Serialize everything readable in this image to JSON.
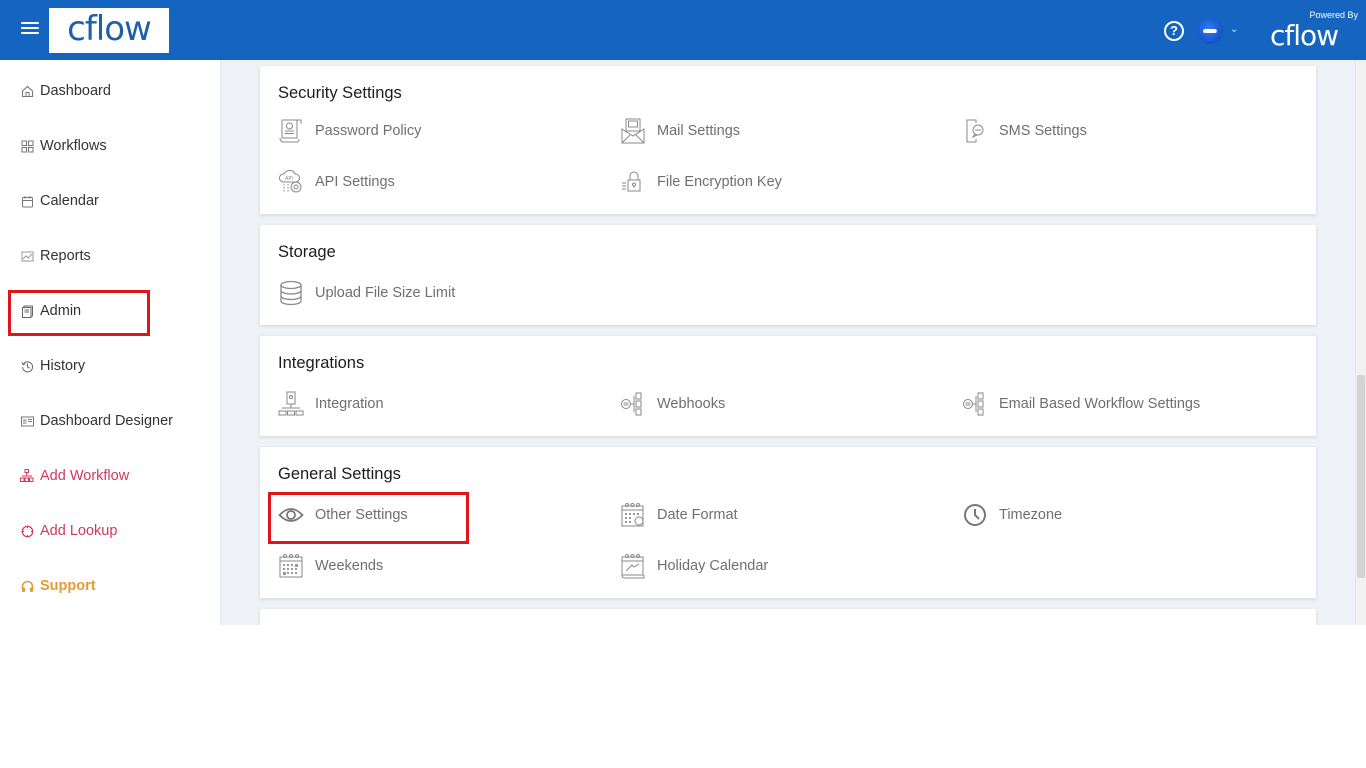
{
  "header": {
    "logo_text": "cflow",
    "powered_by_label": "Powered By",
    "powered_by_logo": "cflow",
    "help_icon": "?",
    "avatar_caret": "⌄",
    "brand_color": "#1565c0"
  },
  "sidebar": {
    "items": [
      {
        "label": "Dashboard",
        "icon": "home-icon"
      },
      {
        "label": "Workflows",
        "icon": "grid-icon"
      },
      {
        "label": "Calendar",
        "icon": "calendar-icon"
      },
      {
        "label": "Reports",
        "icon": "reports-icon"
      },
      {
        "label": "Admin",
        "icon": "admin-icon"
      },
      {
        "label": "History",
        "icon": "history-icon"
      },
      {
        "label": "Dashboard Designer",
        "icon": "dashboard-designer-icon"
      },
      {
        "label": "Add Workflow",
        "icon": "add-workflow-icon"
      },
      {
        "label": "Add Lookup",
        "icon": "add-lookup-icon"
      },
      {
        "label": "Support",
        "icon": "headset-icon"
      }
    ],
    "accent_pink": "#d2395a",
    "accent_orange": "#e39a3a",
    "highlight_color": "#e0151b"
  },
  "sections": [
    {
      "title": "Security Settings",
      "items": [
        {
          "label": "Password Policy",
          "icon": "password-policy-icon"
        },
        {
          "label": "Mail Settings",
          "icon": "mail-icon"
        },
        {
          "label": "SMS Settings",
          "icon": "sms-icon"
        },
        {
          "label": "API Settings",
          "icon": "api-icon"
        },
        {
          "label": "File Encryption Key",
          "icon": "lock-icon"
        }
      ]
    },
    {
      "title": "Storage",
      "items": [
        {
          "label": "Upload File Size Limit",
          "icon": "database-icon"
        }
      ]
    },
    {
      "title": "Integrations",
      "items": [
        {
          "label": "Integration",
          "icon": "integration-icon"
        },
        {
          "label": "Webhooks",
          "icon": "webhooks-icon"
        },
        {
          "label": "Email Based Workflow Settings",
          "icon": "email-workflow-icon"
        }
      ]
    },
    {
      "title": "General Settings",
      "items": [
        {
          "label": "Other Settings",
          "icon": "eye-icon"
        },
        {
          "label": "Date Format",
          "icon": "date-format-icon"
        },
        {
          "label": "Timezone",
          "icon": "clock-icon"
        },
        {
          "label": "Weekends",
          "icon": "weekends-icon"
        },
        {
          "label": "Holiday Calendar",
          "icon": "holiday-calendar-icon"
        }
      ]
    }
  ]
}
